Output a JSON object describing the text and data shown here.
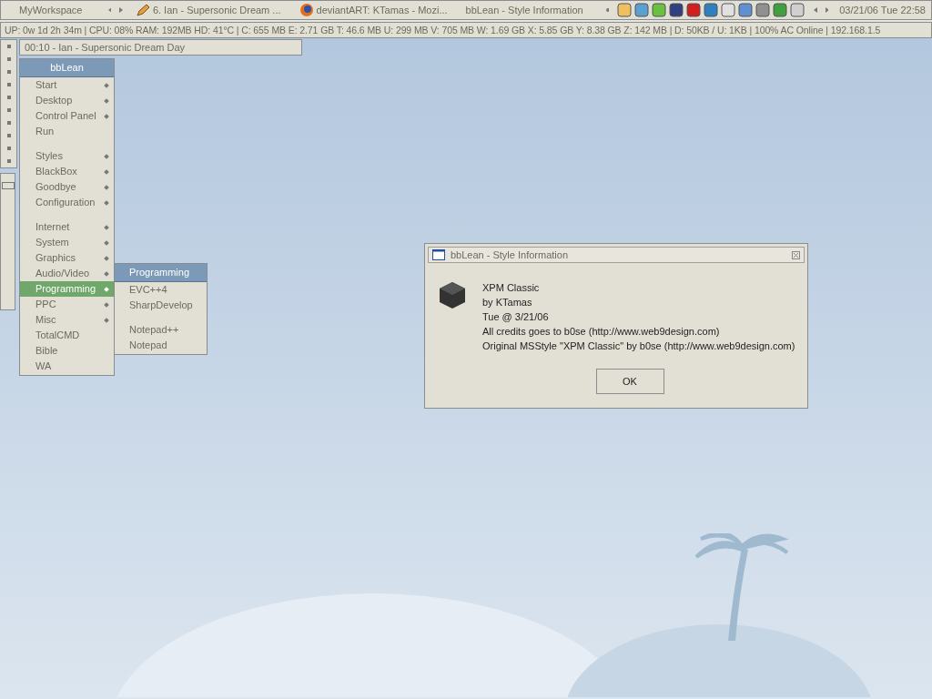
{
  "taskbar": {
    "workspace": "MyWorkspace",
    "tasks": [
      {
        "label": "6. Ian - Supersonic Dream ...",
        "kind": "player"
      },
      {
        "label": "deviantART: KTamas - Mozi...",
        "kind": "browser"
      },
      {
        "label": "bbLean - Style Information",
        "kind": "plain"
      }
    ],
    "clock": "03/21/06 Tue 22:58"
  },
  "status_bar": "UP: 0w 1d 2h 34m | CPU: 08% RAM: 192MB HD: 41°C | C: 655 MB E: 2.71 GB T: 46.6 MB U: 299 MB V: 705 MB W: 1.69 GB X: 5.85 GB Y: 8.38 GB Z: 142 MB | D: 50KB / U: 1KB | 100% AC Online | 192.168.1.5",
  "now_playing": "00:10 - Ian - Supersonic Dream Day",
  "menu": {
    "title": "bbLean",
    "items": [
      {
        "label": "Start",
        "submenu": true,
        "selected": false,
        "gap_before": false
      },
      {
        "label": "Desktop",
        "submenu": true,
        "selected": false,
        "gap_before": false
      },
      {
        "label": "Control Panel",
        "submenu": true,
        "selected": false,
        "gap_before": false
      },
      {
        "label": "Run",
        "submenu": false,
        "selected": false,
        "gap_before": false
      },
      {
        "label": "Styles",
        "submenu": true,
        "selected": false,
        "gap_before": true
      },
      {
        "label": "BlackBox",
        "submenu": true,
        "selected": false,
        "gap_before": false
      },
      {
        "label": "Goodbye",
        "submenu": true,
        "selected": false,
        "gap_before": false
      },
      {
        "label": "Configuration",
        "submenu": true,
        "selected": false,
        "gap_before": false
      },
      {
        "label": "Internet",
        "submenu": true,
        "selected": false,
        "gap_before": true
      },
      {
        "label": "System",
        "submenu": true,
        "selected": false,
        "gap_before": false
      },
      {
        "label": "Graphics",
        "submenu": true,
        "selected": false,
        "gap_before": false
      },
      {
        "label": "Audio/Video",
        "submenu": true,
        "selected": false,
        "gap_before": false
      },
      {
        "label": "Programming",
        "submenu": true,
        "selected": true,
        "gap_before": false
      },
      {
        "label": "PPC",
        "submenu": true,
        "selected": false,
        "gap_before": false
      },
      {
        "label": "Misc",
        "submenu": true,
        "selected": false,
        "gap_before": false
      },
      {
        "label": "TotalCMD",
        "submenu": false,
        "selected": false,
        "gap_before": false
      },
      {
        "label": "Bible",
        "submenu": false,
        "selected": false,
        "gap_before": false
      },
      {
        "label": "WA",
        "submenu": false,
        "selected": false,
        "gap_before": false
      }
    ]
  },
  "submenu": {
    "title": "Programming",
    "items": [
      {
        "label": "EVC++4",
        "gap_before": false
      },
      {
        "label": "SharpDevelop",
        "gap_before": false
      },
      {
        "label": "Notepad++",
        "gap_before": true
      },
      {
        "label": "Notepad",
        "gap_before": false
      }
    ]
  },
  "dialog": {
    "title": "bbLean - Style Information",
    "lines": [
      "XPM Classic",
      "by KTamas",
      "Tue @ 3/21/06",
      "All credits goes to b0se (http://www.web9design.com)",
      "Original MSStyle \"XPM Classic\" by b0se (http://www.web9design.com)"
    ],
    "button": "OK"
  }
}
